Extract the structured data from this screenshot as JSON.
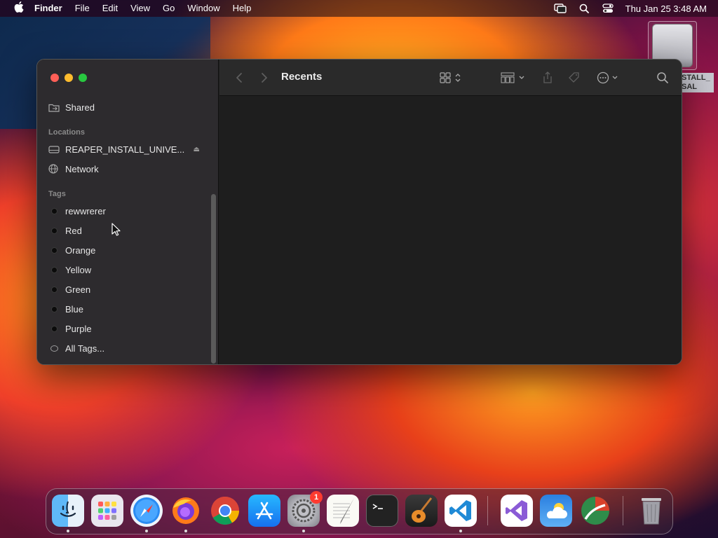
{
  "menubar": {
    "app_name": "Finder",
    "menus": [
      "File",
      "Edit",
      "View",
      "Go",
      "Window",
      "Help"
    ],
    "clock": "Thu Jan 25  3:48 AM"
  },
  "desktop": {
    "drive_label_line1": "STALL_",
    "drive_label_line2": "SAL"
  },
  "finder": {
    "title": "Recents",
    "sidebar": {
      "shared_label": "Shared",
      "locations_header": "Locations",
      "locations": [
        {
          "label": "REAPER_INSTALL_UNIVE...",
          "icon": "drive-icon",
          "ejectable": true
        },
        {
          "label": "Network",
          "icon": "globe-icon",
          "ejectable": false
        }
      ],
      "tags_header": "Tags",
      "tags": [
        {
          "label": "rewwrerer"
        },
        {
          "label": "Red"
        },
        {
          "label": "Orange"
        },
        {
          "label": "Yellow"
        },
        {
          "label": "Green"
        },
        {
          "label": "Blue"
        },
        {
          "label": "Purple"
        }
      ],
      "all_tags_label": "All Tags..."
    }
  },
  "dock": {
    "apps": [
      {
        "name": "finder-icon",
        "running": true
      },
      {
        "name": "launchpad-icon",
        "running": false
      },
      {
        "name": "safari-icon",
        "running": true
      },
      {
        "name": "firefox-icon",
        "running": true
      },
      {
        "name": "chrome-icon",
        "running": false
      },
      {
        "name": "app-store-icon",
        "running": false
      },
      {
        "name": "system-settings-icon",
        "running": true,
        "badge": "1"
      },
      {
        "name": "textedit-icon",
        "running": false
      },
      {
        "name": "terminal-icon",
        "running": false
      },
      {
        "name": "garageband-icon",
        "running": false
      },
      {
        "name": "vscode-icon",
        "running": true
      },
      {
        "name": "visual-studio-icon",
        "running": false
      },
      {
        "name": "weather-icon",
        "running": false
      },
      {
        "name": "reaper-icon",
        "running": false
      },
      {
        "name": "trash-icon",
        "running": false
      }
    ]
  },
  "colors": {
    "close": "#ff5f57",
    "minimize": "#febc2e",
    "maximize": "#28c840",
    "badge": "#ff3b30"
  }
}
